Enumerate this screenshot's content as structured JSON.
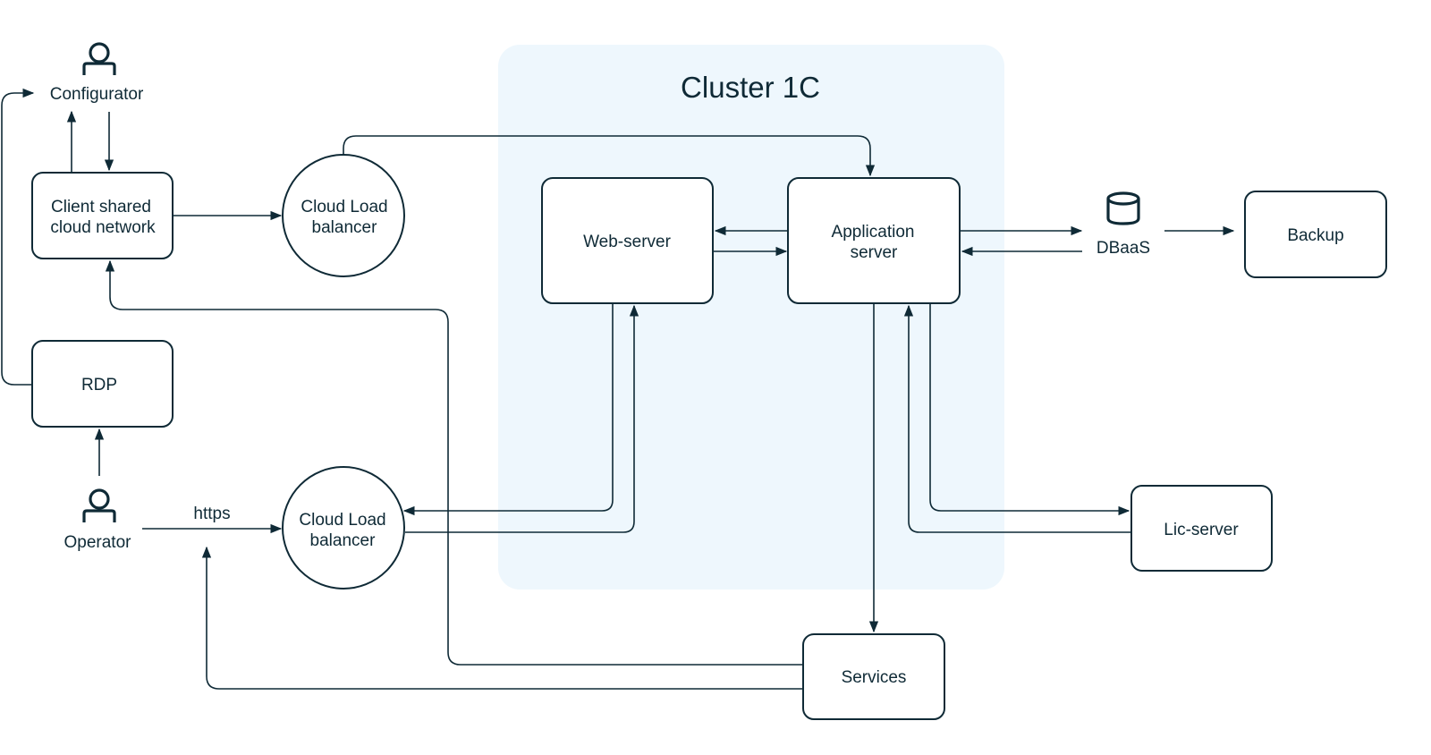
{
  "colors": {
    "ink": "#0f2a36",
    "cluster_bg": "#eef7fd",
    "background": "#ffffff"
  },
  "cluster": {
    "title": "Cluster 1C"
  },
  "nodes": {
    "configurator": {
      "label": "Configurator",
      "icon": "user-icon"
    },
    "client_network": {
      "line1": "Client shared",
      "line2": "cloud network"
    },
    "load_balancer_top": {
      "line1": "Cloud Load",
      "line2": "balancer"
    },
    "web_server": {
      "label": "Web-server"
    },
    "app_server": {
      "line1": "Application",
      "line2": "server"
    },
    "dbaas": {
      "label": "DBaaS",
      "icon": "database-icon"
    },
    "backup": {
      "label": "Backup"
    },
    "rdp": {
      "label": "RDP"
    },
    "operator": {
      "label": "Operator",
      "icon": "user-icon"
    },
    "load_balancer_bottom": {
      "line1": "Cloud Load",
      "line2": "balancer"
    },
    "lic_server": {
      "label": "Lic-server"
    },
    "services": {
      "label": "Services"
    }
  },
  "edges": {
    "operator_to_balancer": {
      "label": "https"
    }
  }
}
